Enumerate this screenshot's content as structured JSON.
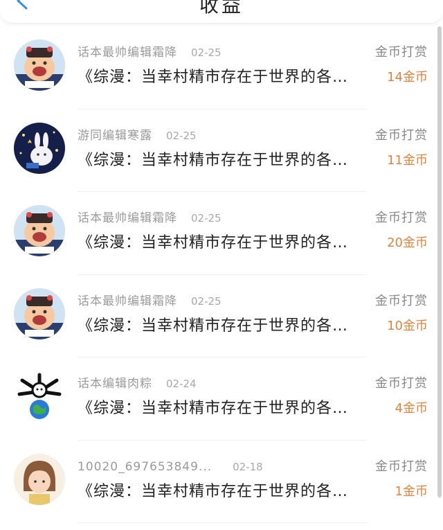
{
  "header": {
    "title": "收益"
  },
  "colors": {
    "accent": "#e8823a",
    "back_icon": "#3a8ee6"
  },
  "items": [
    {
      "name": "话本最帅编辑霜降",
      "date": "02-25",
      "title": "《综漫：当幸村精市存在于世界的各…",
      "type": "金币打赏",
      "amount": "14金币",
      "avatar": "cartoon-boy-hat"
    },
    {
      "name": "游同编辑寒露",
      "date": "02-25",
      "title": "《综漫：当幸村精市存在于世界的各…",
      "type": "金币打赏",
      "amount": "11金币",
      "avatar": "night-bunny"
    },
    {
      "name": "话本最帅编辑霜降",
      "date": "02-25",
      "title": "《综漫：当幸村精市存在于世界的各…",
      "type": "金币打赏",
      "amount": "20金币",
      "avatar": "cartoon-boy-hat"
    },
    {
      "name": "话本最帅编辑霜降",
      "date": "02-25",
      "title": "《综漫：当幸村精市存在于世界的各…",
      "type": "金币打赏",
      "amount": "10金币",
      "avatar": "cartoon-boy-hat"
    },
    {
      "name": "话本编辑肉粽",
      "date": "02-24",
      "title": "《综漫：当幸村精市存在于世界的各…",
      "type": "金币打赏",
      "amount": "4金币",
      "avatar": "bones-earth"
    },
    {
      "name": "10020_697653849...",
      "date": "02-18",
      "title": "《综漫：当幸村精市存在于世界的各…",
      "type": "金币打赏",
      "amount": "1金币",
      "avatar": "girl-bob-hair"
    }
  ]
}
